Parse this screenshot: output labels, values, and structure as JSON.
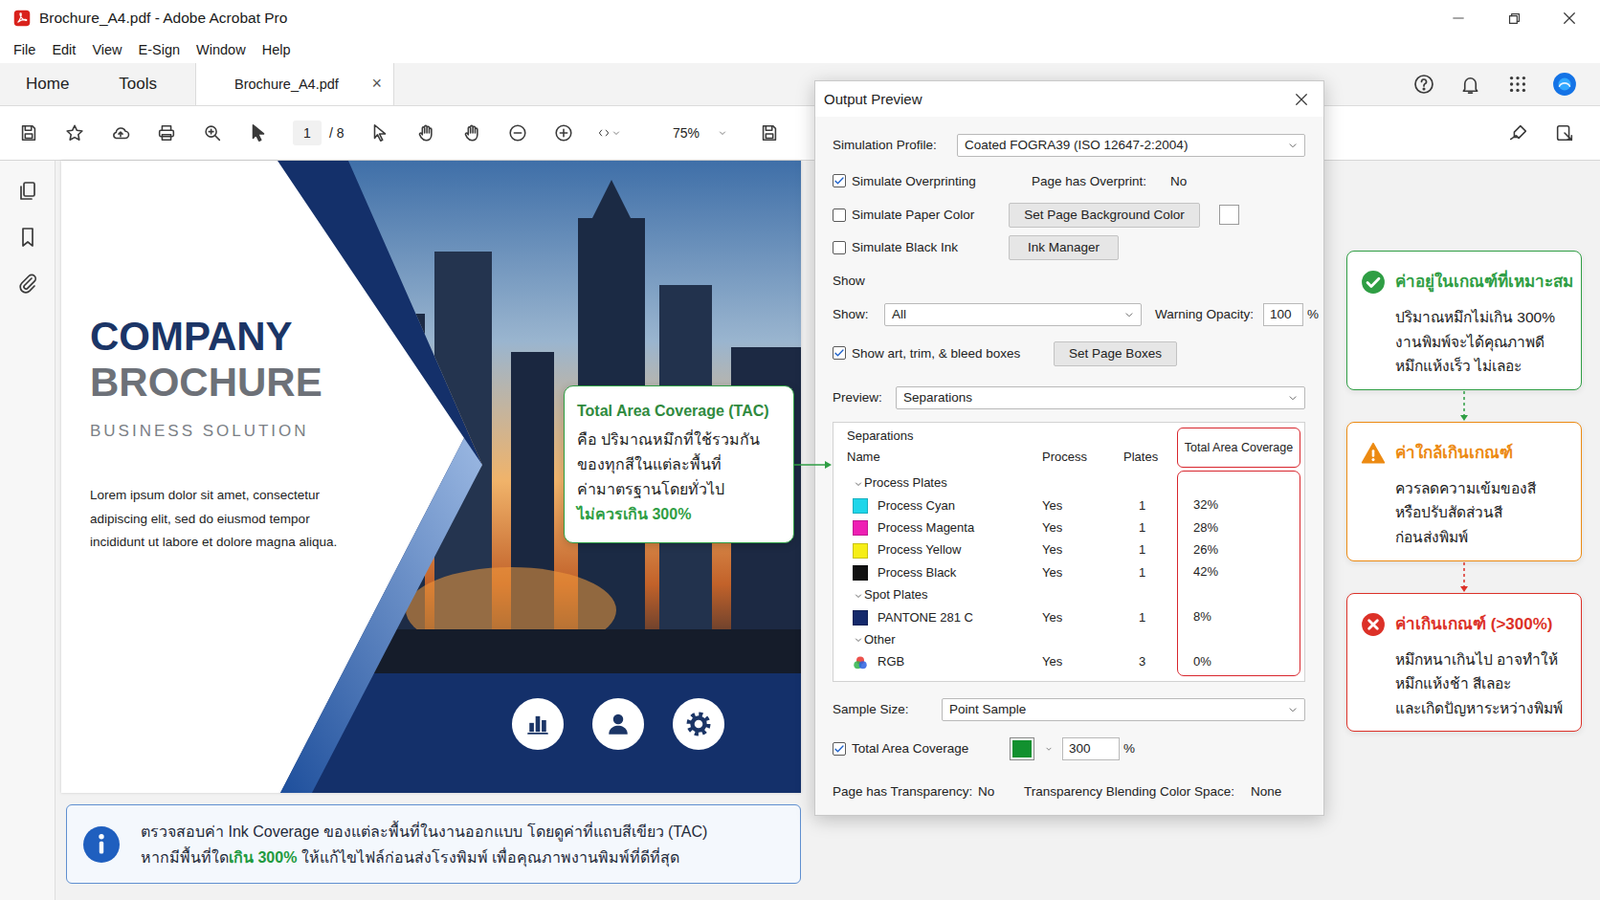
{
  "window": {
    "title": "Brochure_A4.pdf - Adobe Acrobat Pro"
  },
  "menu": [
    "File",
    "Edit",
    "View",
    "E-Sign",
    "Window",
    "Help"
  ],
  "tabs": [
    {
      "label": "Home",
      "selected": false
    },
    {
      "label": "Tools",
      "selected": false
    },
    {
      "label": "Brochure_A4.pdf",
      "selected": true,
      "close": "×"
    }
  ],
  "toolbar": {
    "page_current": "1",
    "page_total": "/ 8",
    "zoom": "75%"
  },
  "document": {
    "heading": [
      "COMPANY",
      "BROCHURE"
    ],
    "subtitle": "BUSINESS SOLUTION",
    "body": [
      "Lorem ipsum dolor sit amet, consectetur",
      "adipiscing elit, sed do eiusmod tempor",
      "incididunt ut labore et dolore magna aliqua."
    ]
  },
  "tac_callout": {
    "title": "Total Area Coverage (TAC)",
    "lines": [
      "คือ ปริมาณหมึกที่ใช้รวมกัน",
      "ของทุกสีในแต่ละพื้นที่",
      "ค่ามาตรฐานโดยทั่วไป"
    ],
    "highlight": "ไม่ควรเกิน 300%"
  },
  "info_note": {
    "lines": [
      [
        {
          "text": "ตรวจสอบค่า Ink Coverage ของแต่ละพื้นที่ในงานออกแบบ โดยดูค่าที่แถบสีเขียว (TAC)",
          "highlight": false
        }
      ],
      [
        {
          "text": "หากมีพื้นที่ใด",
          "highlight": false
        },
        {
          "text": "เกิน 300%",
          "highlight": true
        },
        {
          "text": " ให้แก้ไขไฟล์ก่อนส่งโรงพิมพ์ เพื่อคุณภาพงานพิมพ์ที่ดีที่สุด",
          "highlight": false
        }
      ]
    ]
  },
  "output_preview": {
    "title": "Output Preview",
    "simulation_profile": {
      "label": "Simulation Profile:",
      "value": "Coated FOGRA39 (ISO 12647-2:2004)"
    },
    "simulate_overprinting": {
      "label": "Simulate Overprinting",
      "checked": true
    },
    "page_has_overprint": {
      "label": "Page has Overprint:",
      "value": "No"
    },
    "simulate_paper_color": {
      "label": "Simulate Paper Color",
      "checked": false
    },
    "set_page_background_color": "Set Page Background Color",
    "page_background_color": "#ffffff",
    "simulate_black_ink": {
      "label": "Simulate Black Ink",
      "checked": false
    },
    "ink_manager": "Ink Manager",
    "show_heading": "Show",
    "show": {
      "label": "Show:",
      "value": "All"
    },
    "warning_opacity": {
      "label": "Warning Opacity:",
      "value": "100",
      "unit": "%"
    },
    "show_boxes": {
      "label": "Show art, trim, & bleed boxes",
      "checked": true
    },
    "set_page_boxes": "Set Page Boxes",
    "preview": {
      "label": "Preview:",
      "value": "Separations"
    },
    "separations": {
      "title": "Separations",
      "columns": [
        "Name",
        "Process",
        "Plates",
        "Total Area Coverage"
      ],
      "groups": [
        {
          "label": "Process Plates",
          "expanded": true,
          "plates": [
            {
              "name": "Process Cyan",
              "kind": "swatch",
              "color": "#1ed6ea",
              "process": "Yes",
              "plates": "1",
              "coverage": "32%"
            },
            {
              "name": "Process Magenta",
              "kind": "swatch",
              "color": "#ee1fb4",
              "process": "Yes",
              "plates": "1",
              "coverage": "28%"
            },
            {
              "name": "Process Yellow",
              "kind": "swatch",
              "color": "#f6ee16",
              "process": "Yes",
              "plates": "1",
              "coverage": "26%"
            },
            {
              "name": "Process Black",
              "kind": "swatch",
              "color": "#111111",
              "process": "Yes",
              "plates": "1",
              "coverage": "42%"
            }
          ]
        },
        {
          "label": "Spot Plates",
          "expanded": true,
          "plates": [
            {
              "name": "PANTONE 281 C",
              "kind": "swatch",
              "color": "#14296b",
              "process": "Yes",
              "plates": "1",
              "coverage": "8%"
            }
          ]
        },
        {
          "label": "Other",
          "expanded": true,
          "plates": [
            {
              "name": "RGB",
              "kind": "rgb",
              "process": "Yes",
              "plates": "3",
              "coverage": "0%"
            }
          ]
        }
      ]
    },
    "sample_size": {
      "label": "Sample Size:",
      "value": "Point Sample"
    },
    "total_area_coverage": {
      "label": "Total Area Coverage",
      "checked": true,
      "color": "#12912f",
      "value": "300",
      "unit": "%"
    },
    "transparency": {
      "label": "Page has Transparency:",
      "value": "No"
    },
    "blending": {
      "label": "Transparency Blending Color Space:",
      "value": "None"
    }
  },
  "guide": [
    {
      "kind": "ok",
      "color": "#2f9e44",
      "title": "ค่าอยู่ในเกณฑ์ที่เหมาะสม",
      "lines": [
        "ปริมาณหมึกไม่เกิน 300%",
        "งานพิมพ์จะได้คุณภาพดี",
        "หมึกแห้งเร็ว ไม่เลอะ"
      ]
    },
    {
      "kind": "warning",
      "color": "#ec8a12",
      "title": "ค่าใกล้เกินเกณฑ์",
      "lines": [
        "ควรลดความเข้มของสี",
        "หรือปรับสัดส่วนสี",
        "ก่อนส่งพิมพ์"
      ]
    },
    {
      "kind": "error",
      "color": "#dc3128",
      "title": "ค่าเกินเกณฑ์ (>300%)",
      "lines": [
        "หมึกหนาเกินไป อาจทำให้",
        "หมึกแห้งช้า สีเลอะ",
        "และเกิดปัญหาระหว่างพิมพ์"
      ]
    }
  ]
}
